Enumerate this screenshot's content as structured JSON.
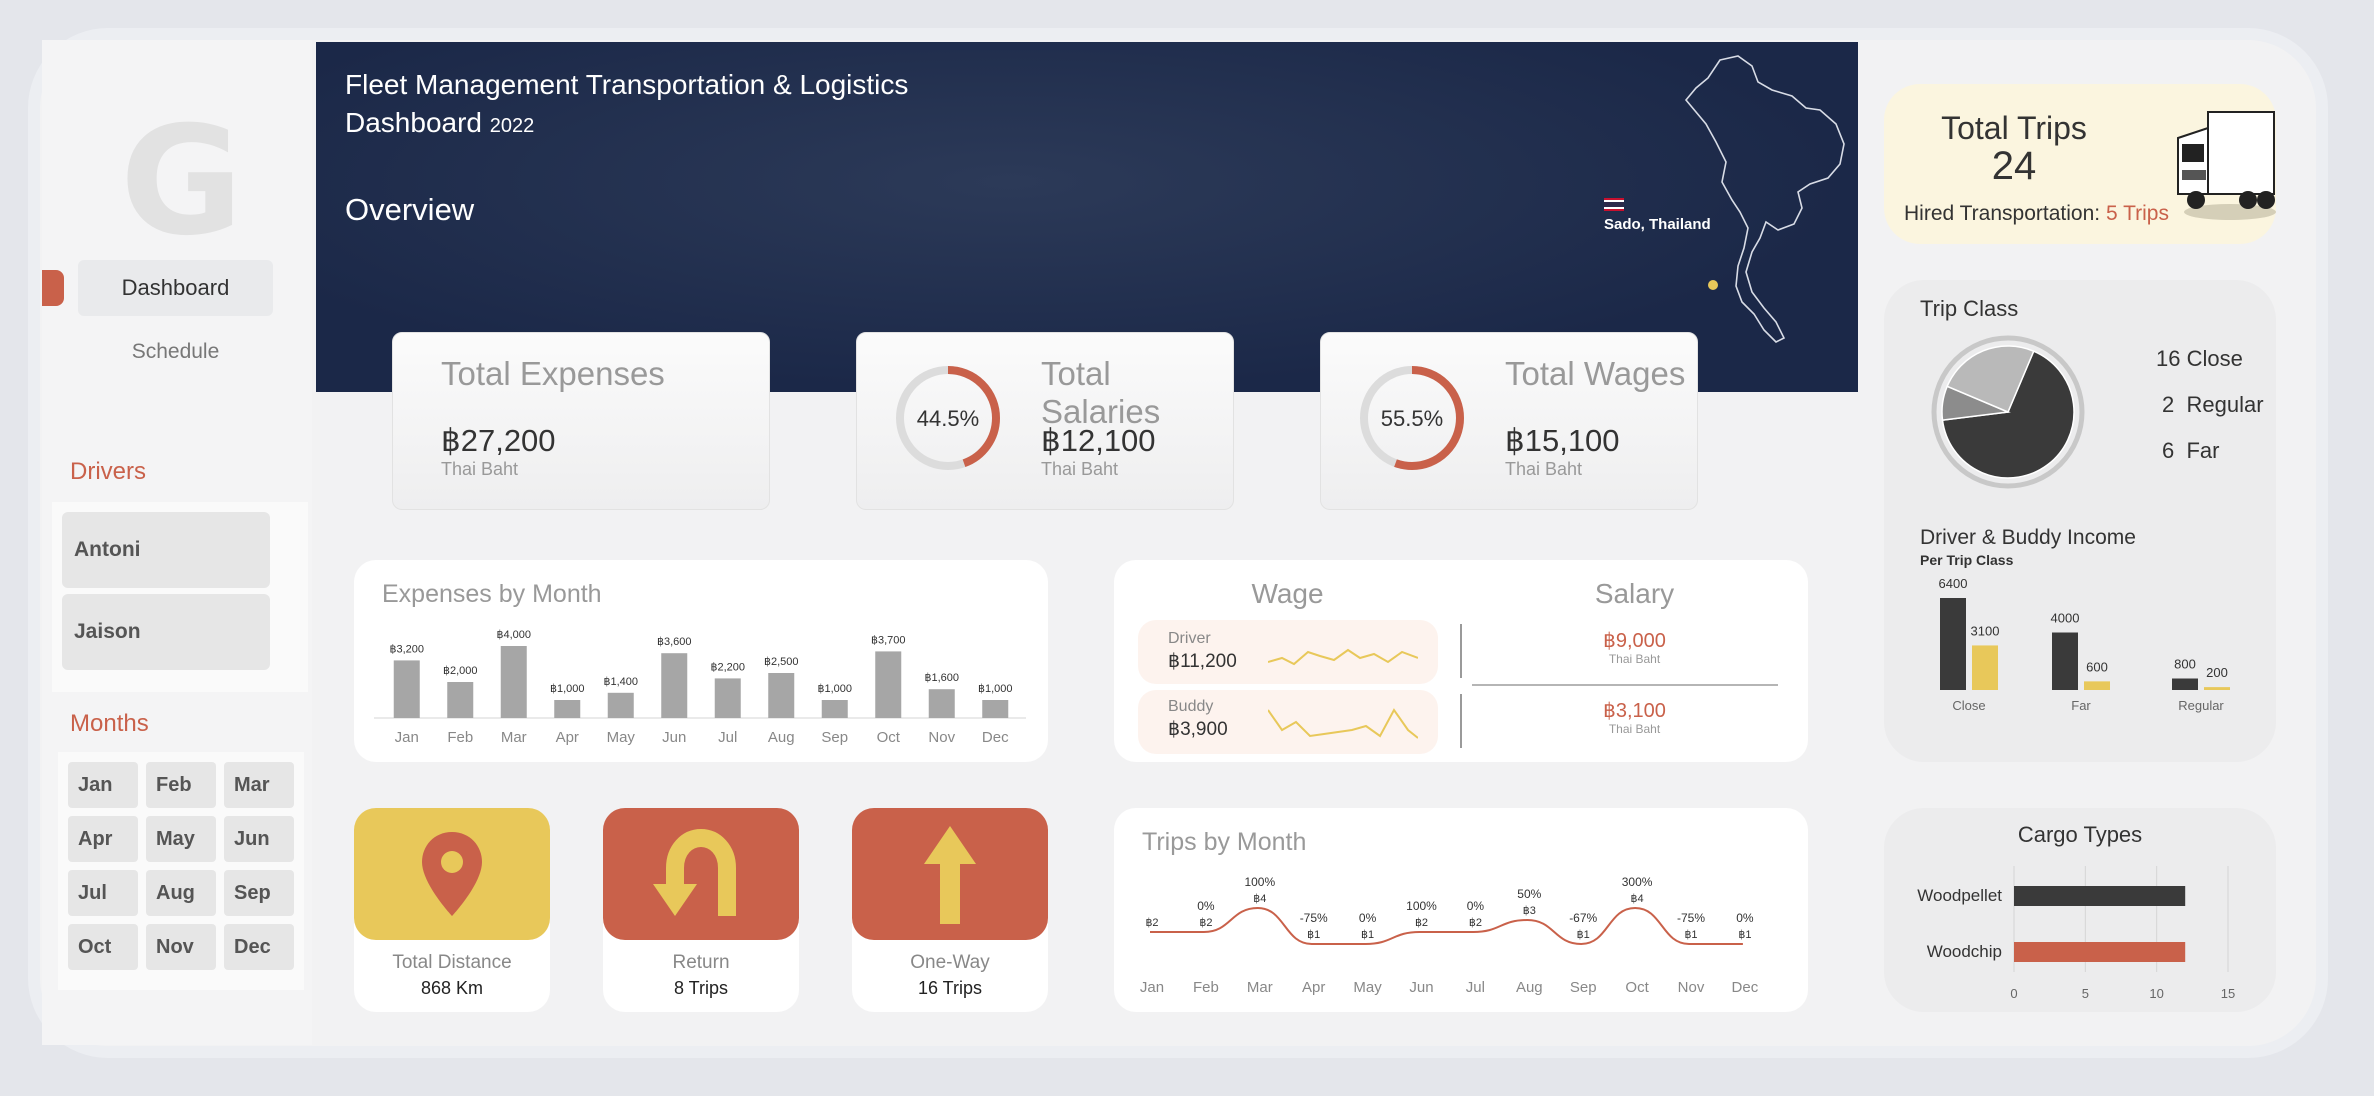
{
  "sidebar": {
    "logo": "G",
    "nav": [
      {
        "label": "Dashboard"
      },
      {
        "label": "Schedule"
      }
    ],
    "drivers_title": "Drivers",
    "drivers": [
      "Antoni",
      "Jaison"
    ],
    "months_title": "Months",
    "months": [
      "Jan",
      "Feb",
      "Mar",
      "Apr",
      "May",
      "Jun",
      "Jul",
      "Aug",
      "Sep",
      "Oct",
      "Nov",
      "Dec"
    ]
  },
  "header": {
    "title_line1": "Fleet Management Transportation & Logistics",
    "title_line2": "Dashboard",
    "year": "2022",
    "overview": "Overview",
    "location": "Sado, Thailand"
  },
  "kpis": {
    "expenses": {
      "title": "Total Expenses",
      "value": "฿27,200",
      "unit": "Thai Baht"
    },
    "salaries": {
      "title": "Total Salaries",
      "value": "฿12,100",
      "unit": "Thai Baht",
      "percent": "44.5%",
      "ratio": 0.445
    },
    "wages": {
      "title": "Total Wages",
      "value": "฿15,100",
      "unit": "Thai Baht",
      "percent": "55.5%",
      "ratio": 0.555
    }
  },
  "expenses_by_month": {
    "title": "Expenses by Month",
    "chart_data": {
      "type": "bar",
      "categories": [
        "Jan",
        "Feb",
        "Mar",
        "Apr",
        "May",
        "Jun",
        "Jul",
        "Aug",
        "Sep",
        "Oct",
        "Nov",
        "Dec"
      ],
      "values": [
        3200,
        2000,
        4000,
        1000,
        1400,
        3600,
        2200,
        2500,
        1000,
        3700,
        1600,
        1000
      ],
      "labels": [
        "฿3,200",
        "฿2,000",
        "฿4,000",
        "฿1,000",
        "฿1,400",
        "฿3,600",
        "฿2,200",
        "฿2,500",
        "฿1,000",
        "฿3,700",
        "฿1,600",
        "฿1,000"
      ],
      "ylim": [
        0,
        4000
      ],
      "color": "#a6a6a6"
    }
  },
  "wage_salary": {
    "wage_title": "Wage",
    "salary_title": "Salary",
    "driver_label": "Driver",
    "driver_value": "฿11,200",
    "buddy_label": "Buddy",
    "buddy_value": "฿3,900",
    "salary_driver": "฿9,000",
    "salary_driver_unit": "Thai Baht",
    "salary_buddy": "฿3,100",
    "salary_buddy_unit": "Thai Baht"
  },
  "tiles": {
    "distance": {
      "label": "Total Distance",
      "value": "868 Km"
    },
    "return": {
      "label": "Return",
      "value": "8 Trips"
    },
    "oneway": {
      "label": "One-Way",
      "value": "16 Trips"
    }
  },
  "trips_by_month": {
    "title": "Trips by Month",
    "chart_data": {
      "type": "line",
      "categories": [
        "Jan",
        "Feb",
        "Mar",
        "Apr",
        "May",
        "Jun",
        "Jul",
        "Aug",
        "Sep",
        "Oct",
        "Nov",
        "Dec"
      ],
      "values": [
        2,
        2,
        4,
        1,
        1,
        2,
        2,
        3,
        1,
        4,
        1,
        1
      ],
      "value_labels": [
        "฿2",
        "฿2",
        "฿4",
        "฿1",
        "฿1",
        "฿2",
        "฿2",
        "฿3",
        "฿1",
        "฿4",
        "฿1",
        "฿1"
      ],
      "change_labels": [
        "",
        "0%",
        "100%",
        "-75%",
        "0%",
        "100%",
        "0%",
        "50%",
        "-67%",
        "300%",
        "-75%",
        "0%"
      ],
      "color": "#c9614a"
    }
  },
  "total_trips": {
    "title": "Total Trips",
    "value": "24",
    "hired_label": "Hired Transportation:",
    "hired_value": "5 Trips"
  },
  "trip_class": {
    "title": "Trip Class",
    "legend": [
      {
        "count": "16",
        "label": "Close"
      },
      {
        "count": "2",
        "label": "Regular"
      },
      {
        "count": "6",
        "label": "Far"
      }
    ],
    "chart_data": {
      "type": "pie",
      "labels": [
        "Close",
        "Regular",
        "Far"
      ],
      "values": [
        16,
        2,
        6
      ],
      "colors": [
        "#3a3a3a",
        "#8c8c8c",
        "#b9b9b9"
      ]
    }
  },
  "income": {
    "title": "Driver & Buddy Income",
    "subtitle": "Per Trip Class",
    "chart_data": {
      "type": "bar",
      "categories": [
        "Close",
        "Far",
        "Regular"
      ],
      "series": [
        {
          "values": [
            6400,
            4000,
            800
          ],
          "color": "#3a3a3a"
        },
        {
          "values": [
            3100,
            600,
            200
          ],
          "color": "#e8c85a"
        }
      ]
    }
  },
  "cargo": {
    "title": "Cargo Types",
    "chart_data": {
      "type": "bar",
      "orientation": "horizontal",
      "categories": [
        "Woodpellet",
        "Woodchip"
      ],
      "values": [
        12,
        12
      ],
      "colors": [
        "#3a3a3a",
        "#c9614a"
      ],
      "xlim": [
        0,
        15
      ],
      "ticks": [
        "0",
        "5",
        "10",
        "15"
      ]
    }
  }
}
